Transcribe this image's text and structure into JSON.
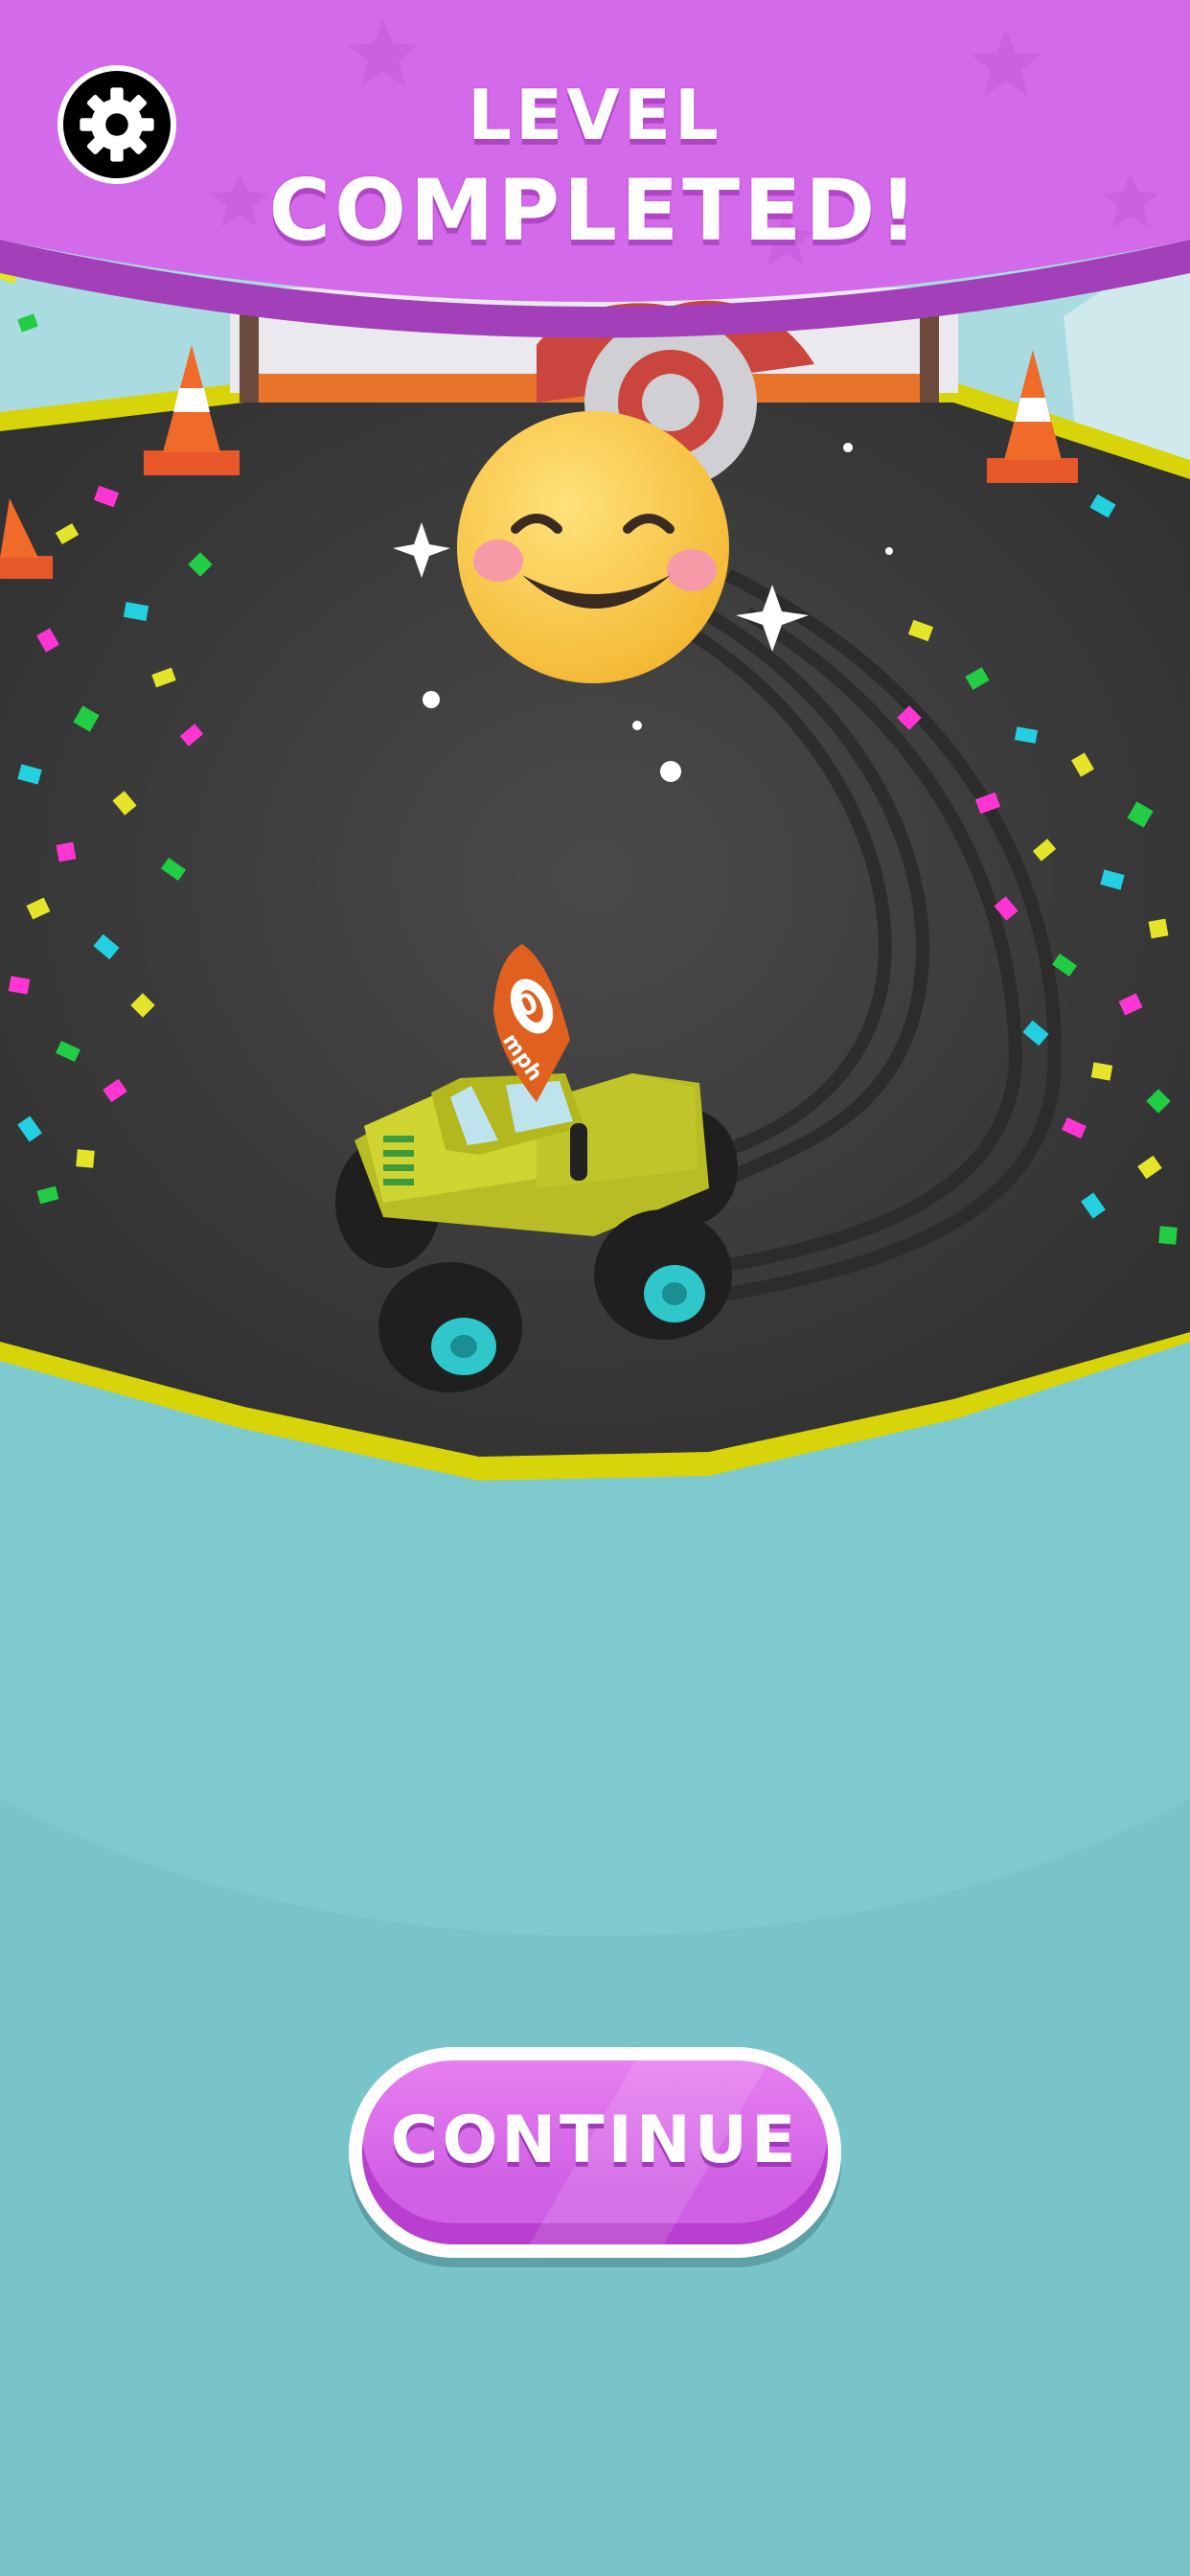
{
  "banner": {
    "title_line1": "LEVEL",
    "title_line2": "COMPLETED!"
  },
  "speed": {
    "value": "0",
    "unit": "mph"
  },
  "continue_button": {
    "label": "CONTINUE"
  },
  "colors": {
    "banner": "#d36ae9",
    "background": "#79c4c9",
    "track": "#3f3f3f",
    "track_edge": "#d8d40a",
    "truck_body": "#c9cf2e",
    "wheel_rim": "#2fc7c9",
    "smiley": "#ffd34d",
    "button": "#d86ee9"
  },
  "icons": {
    "settings": "gear-icon",
    "mood": "smiley-face-icon"
  }
}
